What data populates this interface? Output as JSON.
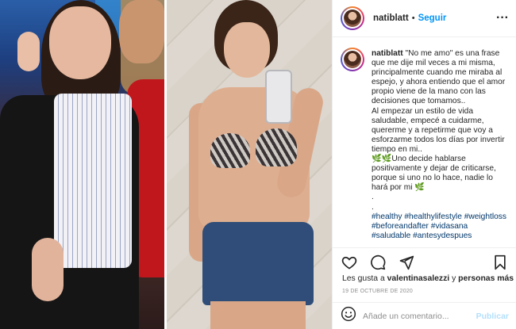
{
  "post": {
    "username": "natiblatt",
    "follow_label": "Seguir",
    "more_icon": "more-options-icon",
    "caption": {
      "lines": [
        "\"No me amo\" es una frase que me dije mil veces a mi misma, principalmente cuando me miraba al espejo, y ahora entiendo que el amor propio viene de la mano con las decisiones que tomamos..",
        "Al empezar un estilo de vida saludable, empecé a cuidarme, quererme y a repetirme que voy a esforzarme todos los días por invertir tiempo en mi..",
        "🌿🌿Uno decide hablarse positivamente y dejar de criticarse, porque si uno no lo hace, nadie lo hará por mi 🌿",
        ".",
        "."
      ],
      "hashtags": [
        "#healthy",
        "#healthylifestyle",
        "#weightloss",
        "#beforeandafter",
        "#vidasana",
        "#saludable",
        "#antesydespues"
      ]
    },
    "likes": {
      "prefix": "Les gusta a",
      "user": "valentinasalezzi",
      "connector": "y",
      "others": "personas más"
    },
    "date": "19 de octubre de 2020",
    "comment": {
      "placeholder": "Añade un comentario...",
      "post_label": "Publicar"
    }
  },
  "colors": {
    "accent": "#0095f6",
    "hashtag": "#00376b",
    "muted": "#8e8e8e",
    "post_disabled": "#b2dffc"
  }
}
